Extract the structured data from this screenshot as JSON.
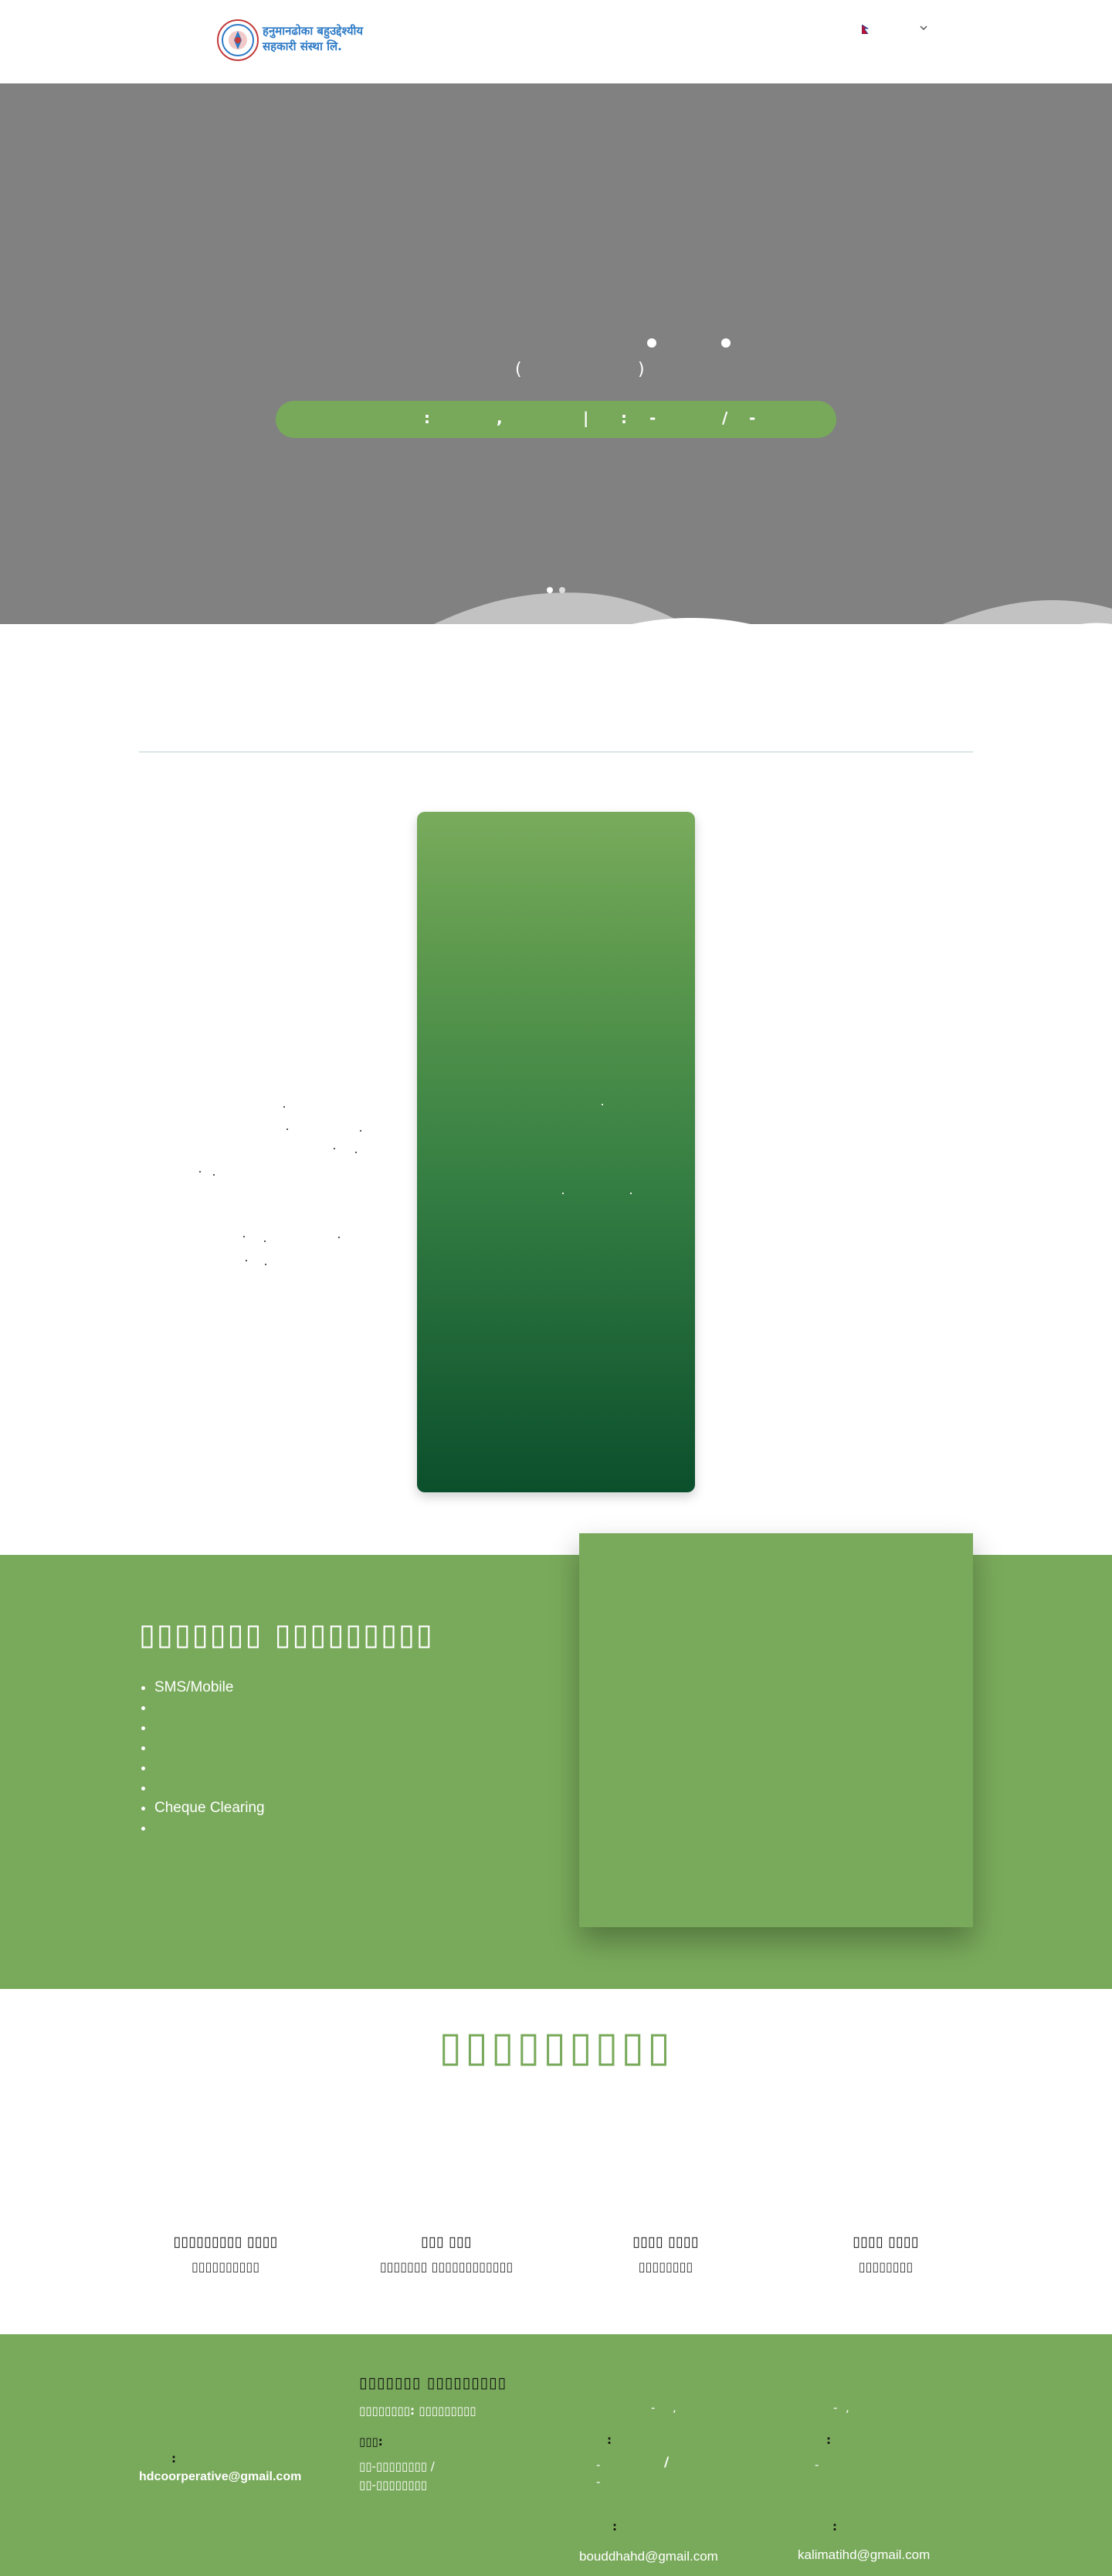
{
  "header": {
    "brand_line1": "हनुमानढोका बहुउद्देश्यीय",
    "brand_line2": "सहकारी संस्था लि."
  },
  "hero": {
    "line2_open": "(",
    "line2_close": ")",
    "bar_text_1": ":",
    "bar_text_2": ",",
    "bar_text_3": "|",
    "bar_text_4": ":",
    "bar_text_5": "-",
    "bar_text_6": "/",
    "bar_text_7": "-"
  },
  "services": {
    "title": "▯▯▯▯▯▯▯ ▯▯▯▯▯▯▯▯▯",
    "items": [
      "SMS/Mobile",
      "",
      "",
      "",
      "",
      "",
      "Cheque Clearing",
      ""
    ]
  },
  "team": {
    "title": "▯▯▯▯▯▯▯▯▯",
    "members": [
      {
        "name": "▯▯▯▯▯▯▯▯▯ ▯▯▯▯",
        "role": "▯▯▯▯▯▯▯▯▯▯"
      },
      {
        "name": "▯▯▯ ▯▯▯",
        "role": "▯▯▯▯▯▯▯ ▯▯▯▯▯▯▯▯▯▯▯▯"
      },
      {
        "name": "▯▯▯▯ ▯▯▯▯",
        "role": "▯▯▯▯▯▯▯▯"
      },
      {
        "name": "▯▯▯▯ ▯▯▯▯",
        "role": "▯▯▯▯▯▯▯▯"
      }
    ]
  },
  "footer": {
    "heading": "▯▯▯▯▯▯▯ ▯▯▯▯▯▯▯▯▯",
    "address": "▯▯▯▯▯▯▯▯: ▯▯▯▯▯▯▯▯▯",
    "phone_label": "▯▯▯:",
    "phone_1": "▯▯-▯▯▯▯▯▯▯▯ /",
    "phone_2": "▯▯-▯▯▯▯▯▯▯▯",
    "email_label": ":",
    "email_main": "hdcoorperative@gmail.com",
    "branch1_email": "bouddhahd@gmail.com",
    "branch2_email": "kalimatihd@gmail.com"
  }
}
